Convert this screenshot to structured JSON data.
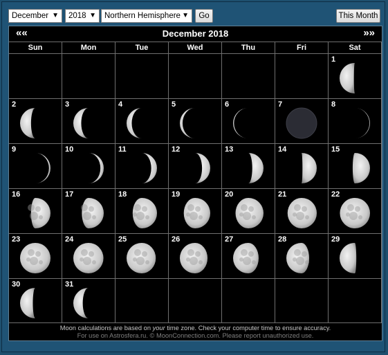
{
  "controls": {
    "month": "December",
    "year": "2018",
    "hemisphere": "Northern Hemisphere",
    "go_label": "Go",
    "this_month_label": "This Month"
  },
  "calendar": {
    "title": "December 2018",
    "prev_label": "««",
    "next_label": "»»",
    "weekdays": [
      "Sun",
      "Mon",
      "Tue",
      "Wed",
      "Thu",
      "Fri",
      "Sat"
    ],
    "first_weekday_index": 6,
    "days_in_month": 31,
    "days": [
      {
        "day": "1",
        "illum": 0.47,
        "phase": "waning"
      },
      {
        "day": "2",
        "illum": 0.36,
        "phase": "waning"
      },
      {
        "day": "3",
        "illum": 0.26,
        "phase": "waning"
      },
      {
        "day": "4",
        "illum": 0.17,
        "phase": "waning"
      },
      {
        "day": "5",
        "illum": 0.09,
        "phase": "waning"
      },
      {
        "day": "6",
        "illum": 0.03,
        "phase": "waning"
      },
      {
        "day": "7",
        "illum": 0.0,
        "phase": "new"
      },
      {
        "day": "8",
        "illum": 0.02,
        "phase": "waxing"
      },
      {
        "day": "9",
        "illum": 0.05,
        "phase": "waxing"
      },
      {
        "day": "10",
        "illum": 0.11,
        "phase": "waxing"
      },
      {
        "day": "11",
        "illum": 0.19,
        "phase": "waxing"
      },
      {
        "day": "12",
        "illum": 0.27,
        "phase": "waxing"
      },
      {
        "day": "13",
        "illum": 0.37,
        "phase": "waxing"
      },
      {
        "day": "14",
        "illum": 0.47,
        "phase": "waxing"
      },
      {
        "day": "15",
        "illum": 0.57,
        "phase": "waxing"
      },
      {
        "day": "16",
        "illum": 0.64,
        "phase": "waxing"
      },
      {
        "day": "17",
        "illum": 0.72,
        "phase": "waxing"
      },
      {
        "day": "18",
        "illum": 0.8,
        "phase": "waxing"
      },
      {
        "day": "19",
        "illum": 0.87,
        "phase": "waxing"
      },
      {
        "day": "20",
        "illum": 0.92,
        "phase": "waxing"
      },
      {
        "day": "21",
        "illum": 0.96,
        "phase": "waxing"
      },
      {
        "day": "22",
        "illum": 0.99,
        "phase": "waxing"
      },
      {
        "day": "23",
        "illum": 1.0,
        "phase": "full"
      },
      {
        "day": "24",
        "illum": 0.99,
        "phase": "waning"
      },
      {
        "day": "25",
        "illum": 0.96,
        "phase": "waning"
      },
      {
        "day": "26",
        "illum": 0.91,
        "phase": "waning"
      },
      {
        "day": "27",
        "illum": 0.84,
        "phase": "waning"
      },
      {
        "day": "28",
        "illum": 0.75,
        "phase": "waning"
      },
      {
        "day": "29",
        "illum": 0.55,
        "phase": "waning"
      },
      {
        "day": "30",
        "illum": 0.42,
        "phase": "waning"
      },
      {
        "day": "31",
        "illum": 0.31,
        "phase": "waning"
      }
    ]
  },
  "footer": {
    "line1_a": "Moon calculations are based on ",
    "line1_em": "your",
    "line1_b": " time zone. Check your computer time to ensure accuracy.",
    "line2": "For use on Astrosfera.ru. © MoonConnection.com. Please report unauthorized use."
  },
  "colors": {
    "page_bg": "#1e4f6e",
    "calendar_bg": "#000000",
    "grid_line": "#6f6f6f",
    "moon_lit": "#d8d8d8",
    "new_moon": "#2b2c34"
  }
}
